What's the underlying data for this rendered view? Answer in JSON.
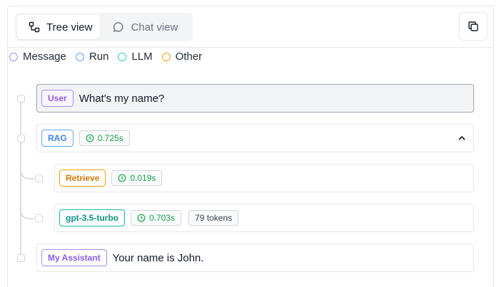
{
  "tabs": [
    {
      "label": "Tree view",
      "icon": "tree-icon",
      "active": true
    },
    {
      "label": "Chat view",
      "icon": "chat-bubble-icon",
      "active": false
    }
  ],
  "copy_button": {
    "icon": "copy-icon"
  },
  "legend": [
    {
      "label": "Message",
      "color": "#a78bfa"
    },
    {
      "label": "Run",
      "color": "#60a5fa"
    },
    {
      "label": "LLM",
      "color": "#2dd4bf"
    },
    {
      "label": "Other",
      "color": "#f59e0b"
    }
  ],
  "nodes": [
    {
      "badge": "User",
      "badge_color": "#8b5cf6",
      "text": "What's my name?",
      "selected": true
    },
    {
      "badge": "RAG",
      "badge_color": "#3b82f6",
      "time": "0.725s",
      "expanded": true
    },
    {
      "badge": "Retrieve",
      "badge_color": "#f59e0b",
      "time": "0.019s"
    },
    {
      "badge": "gpt-3.5-turbo",
      "badge_color": "#14b8a6",
      "time": "0.703s",
      "tokens": "79 tokens"
    },
    {
      "badge": "My Assistant",
      "badge_color": "#8b5cf6",
      "text": "Your name is John."
    }
  ],
  "colors": {
    "time_green": "#16a34a",
    "border": "#e5e7eb"
  }
}
